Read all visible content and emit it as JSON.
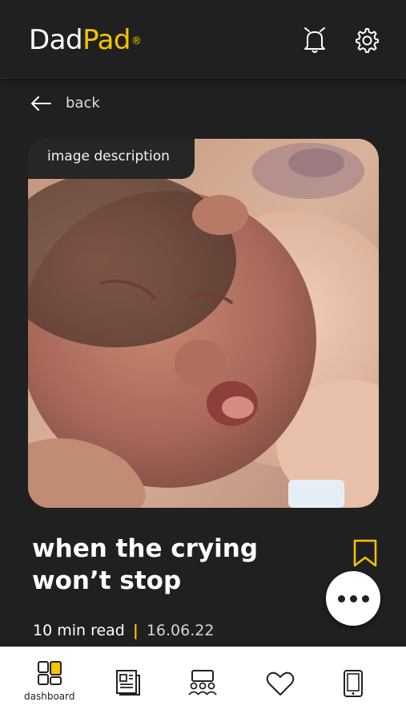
{
  "header": {
    "logo_part1": "Dad",
    "logo_part2": "Pad",
    "logo_mark": "®",
    "icons": [
      "bell-icon",
      "gear-icon"
    ]
  },
  "nav": {
    "back_label": "back"
  },
  "hero": {
    "image_description_label": "image description"
  },
  "article": {
    "title_line1": "when the crying",
    "title_line2": "won’t stop",
    "read_time": "10 min read",
    "separator": "|",
    "date": "16.06.22"
  },
  "tabbar": {
    "items": [
      {
        "label": "dashboard",
        "icon": "dashboard-icon",
        "active": true
      },
      {
        "label": "",
        "icon": "articles-icon"
      },
      {
        "label": "",
        "icon": "community-icon"
      },
      {
        "label": "",
        "icon": "heart-icon"
      },
      {
        "label": "",
        "icon": "tablet-icon"
      }
    ]
  },
  "colors": {
    "accent": "#f5c400",
    "background": "#202020",
    "tabbar": "#ffffff"
  }
}
